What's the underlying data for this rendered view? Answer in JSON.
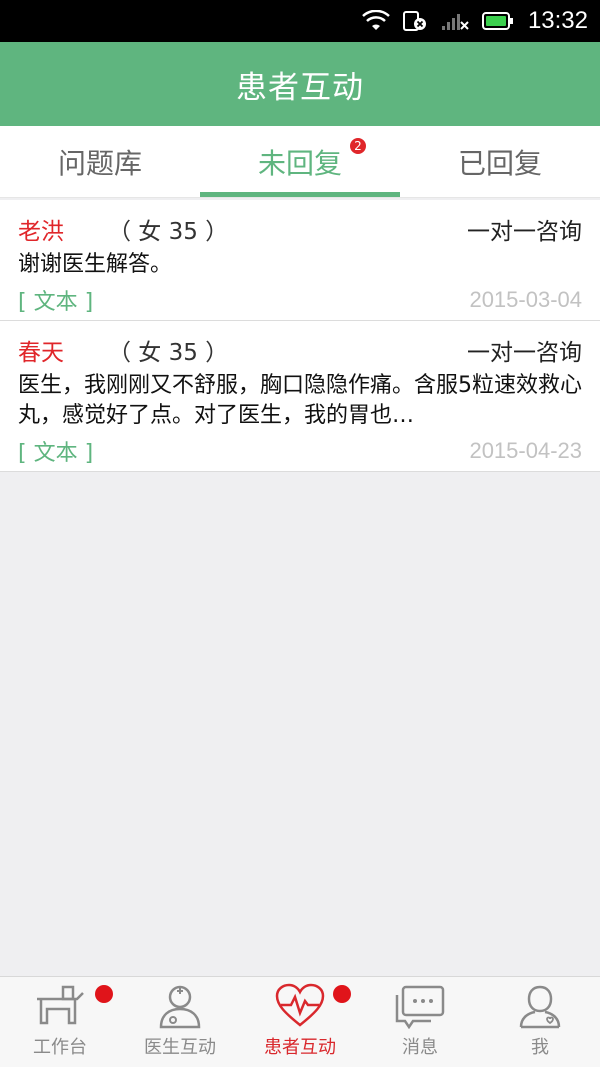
{
  "status_bar": {
    "time": "13:32"
  },
  "header": {
    "title": "患者互动"
  },
  "tabs": [
    {
      "label": "问题库",
      "active": false
    },
    {
      "label": "未回复",
      "active": true,
      "badge": "2"
    },
    {
      "label": "已回复",
      "active": false
    }
  ],
  "items": [
    {
      "name": "老洪",
      "meta": "（ 女 35 ）",
      "type": "一对一咨询",
      "message": "谢谢医生解答。",
      "tag": "[ 文本 ]",
      "date": "2015-03-04"
    },
    {
      "name": "春天",
      "meta": "（ 女 35 ）",
      "type": "一对一咨询",
      "message": "医生，我刚刚又不舒服，胸口隐隐作痛。含服5粒速效救心丸，感觉好了点。对了医生，我的胃也…",
      "tag": "[ 文本 ]",
      "date": "2015-04-23"
    }
  ],
  "bottom_nav": [
    {
      "label": "工作台",
      "icon": "workbench-icon",
      "dot": true
    },
    {
      "label": "医生互动",
      "icon": "doctor-icon",
      "dot": false
    },
    {
      "label": "患者互动",
      "icon": "heartbeat-icon",
      "dot": true,
      "active": true
    },
    {
      "label": "消息",
      "icon": "message-icon",
      "dot": false
    },
    {
      "label": "我",
      "icon": "profile-icon",
      "dot": false
    }
  ],
  "colors": {
    "primary": "#5fb57f",
    "accent_red": "#e0262a",
    "date_gray": "#c2c2c2"
  }
}
